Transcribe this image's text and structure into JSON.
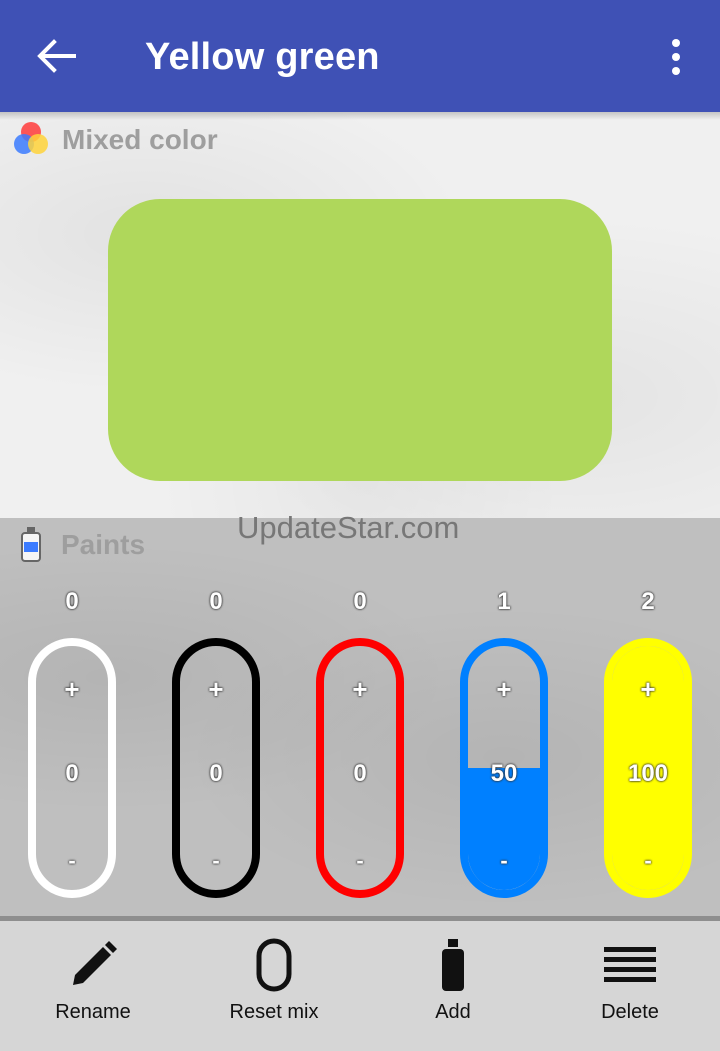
{
  "appbar": {
    "title": "Yellow green",
    "back_icon": "arrow-back-icon",
    "menu_icon": "more-vert-icon"
  },
  "mixed": {
    "label": "Mixed color",
    "color": "#afd75b"
  },
  "paints": {
    "label": "Paints",
    "watermark": "UpdateStar.com",
    "items": [
      {
        "count": "0",
        "value": "0",
        "level": 0,
        "color": "#ffffff",
        "border": "#ffffff",
        "plus": "+",
        "minus": "-"
      },
      {
        "count": "0",
        "value": "0",
        "level": 0,
        "color": "#000000",
        "border": "#000000",
        "plus": "+",
        "minus": "-"
      },
      {
        "count": "0",
        "value": "0",
        "level": 0,
        "color": "#ff0000",
        "border": "#ff0000",
        "plus": "+",
        "minus": "-"
      },
      {
        "count": "1",
        "value": "50",
        "level": 50,
        "color": "#0080ff",
        "border": "#0080ff",
        "plus": "+",
        "minus": "-"
      },
      {
        "count": "2",
        "value": "100",
        "level": 100,
        "color": "#ffff00",
        "border": "#ffff00",
        "plus": "+",
        "minus": "-"
      }
    ]
  },
  "actions": [
    {
      "label": "Rename",
      "icon": "pencil-icon"
    },
    {
      "label": "Reset mix",
      "icon": "zero-icon"
    },
    {
      "label": "Add",
      "icon": "paint-tube-icon"
    },
    {
      "label": "Delete",
      "icon": "menu-lines-icon"
    }
  ]
}
